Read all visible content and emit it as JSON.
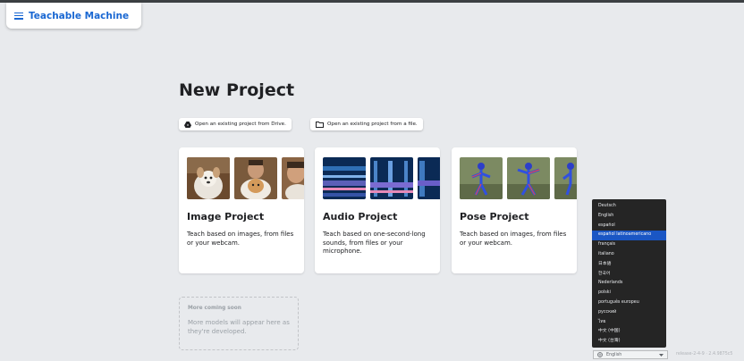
{
  "header": {
    "title": "Teachable Machine"
  },
  "main": {
    "title": "New Project",
    "open_drive_label": "Open an existing project from Drive.",
    "open_file_label": "Open an existing project from a file."
  },
  "cards": [
    {
      "title": "Image Project",
      "description": "Teach based on images, from files or your webcam."
    },
    {
      "title": "Audio Project",
      "description": "Teach based on one-second-long sounds, from files or your microphone."
    },
    {
      "title": "Pose Project",
      "description": "Teach based on images, from files or your webcam."
    }
  ],
  "coming_soon": {
    "title": "More coming soon",
    "description": "More models will appear here as they're developed."
  },
  "language_menu": {
    "options": [
      "Deutsch",
      "English",
      "español",
      "español latinoamericano",
      "français",
      "italiano",
      "日本語",
      "한국어",
      "Nederlands",
      "polski",
      "português europeu",
      "русский",
      "ไทย",
      "中文 (中国)",
      "中文 (台灣)"
    ],
    "highlighted": "español latinoamericano",
    "selected_value": "English"
  },
  "footer": {
    "version": "release-2-4-9 · 2.4.9875c5"
  },
  "colors": {
    "brand_blue": "#1967d2",
    "page_bg": "#e8eaed",
    "menu_bg": "#252525",
    "highlight": "#1a56c4"
  }
}
